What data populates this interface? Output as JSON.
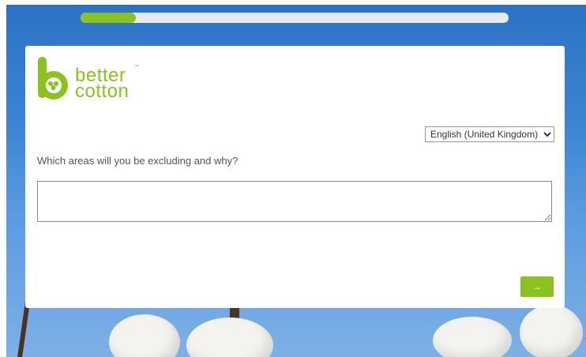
{
  "progress": {
    "fraction": 0.13
  },
  "brand": {
    "logo_line1": "better",
    "logo_line2": "cotton",
    "trademark": "™",
    "color": "#8cc21f"
  },
  "language": {
    "selected": "English (United Kingdom)"
  },
  "question": {
    "text": "Which areas will you be excluding and why?",
    "answer_value": ""
  },
  "navigation": {
    "next_label": "→"
  },
  "colors": {
    "accent": "#8cc21f",
    "sky": "#3d86d4"
  }
}
